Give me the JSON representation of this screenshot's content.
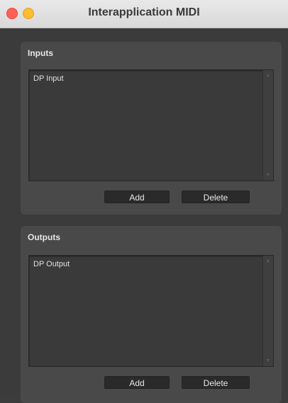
{
  "window": {
    "title": "Interapplication MIDI",
    "buttons": [
      "close",
      "minimize"
    ]
  },
  "inputs": {
    "title": "Inputs",
    "items": [
      "DP Input"
    ],
    "add_label": "Add",
    "delete_label": "Delete"
  },
  "outputs": {
    "title": "Outputs",
    "items": [
      "DP Output"
    ],
    "add_label": "Add",
    "delete_label": "Delete"
  },
  "icons": {
    "scroll_up": "triangle-up-icon",
    "scroll_down": "triangle-down-icon"
  },
  "colors": {
    "close": "#ff5f57",
    "minimize": "#febc2e",
    "background": "#3b3b3b",
    "panel": "#494949"
  }
}
